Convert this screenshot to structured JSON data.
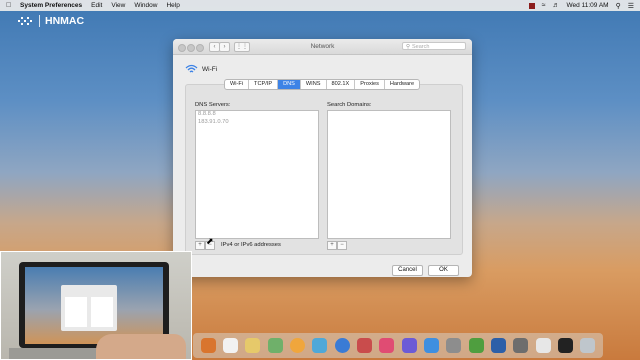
{
  "menubar": {
    "app_name": "System Preferences",
    "menus": [
      "Edit",
      "View",
      "Window",
      "Help"
    ],
    "clock": "Wed 11:09 AM"
  },
  "brand": {
    "name": "HNMAC"
  },
  "window": {
    "title": "Network",
    "search_placeholder": "Search",
    "interface_name": "Wi-Fi",
    "tabs": [
      "Wi-Fi",
      "TCP/IP",
      "DNS",
      "WINS",
      "802.1X",
      "Proxies",
      "Hardware"
    ],
    "active_tab": "DNS",
    "dns_servers_label": "DNS Servers:",
    "dns_servers": [
      "8.8.8.8",
      "183.91.0.70"
    ],
    "search_domains_label": "Search Domains:",
    "hint": "IPv4 or IPv6 addresses",
    "add_symbol": "+",
    "remove_symbol": "−",
    "cancel_label": "Cancel",
    "ok_label": "OK"
  },
  "colors": {
    "accent": "#3d83e6"
  }
}
